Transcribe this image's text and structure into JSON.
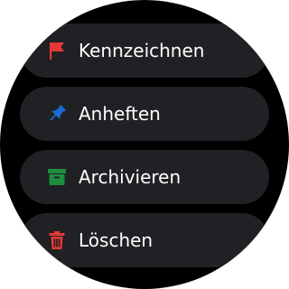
{
  "menu": {
    "items": [
      {
        "label": "Kennzeichnen",
        "icon": "flag-icon",
        "icon_color": "#e53935"
      },
      {
        "label": "Anheften",
        "icon": "pin-icon",
        "icon_color": "#1e6bd6"
      },
      {
        "label": "Archivieren",
        "icon": "archive-icon",
        "icon_color": "#1e8e3e"
      },
      {
        "label": "Löschen",
        "icon": "trash-icon",
        "icon_color": "#e53935"
      }
    ]
  },
  "colors": {
    "background": "#000000",
    "chip": "#202124",
    "text": "#ffffff"
  }
}
